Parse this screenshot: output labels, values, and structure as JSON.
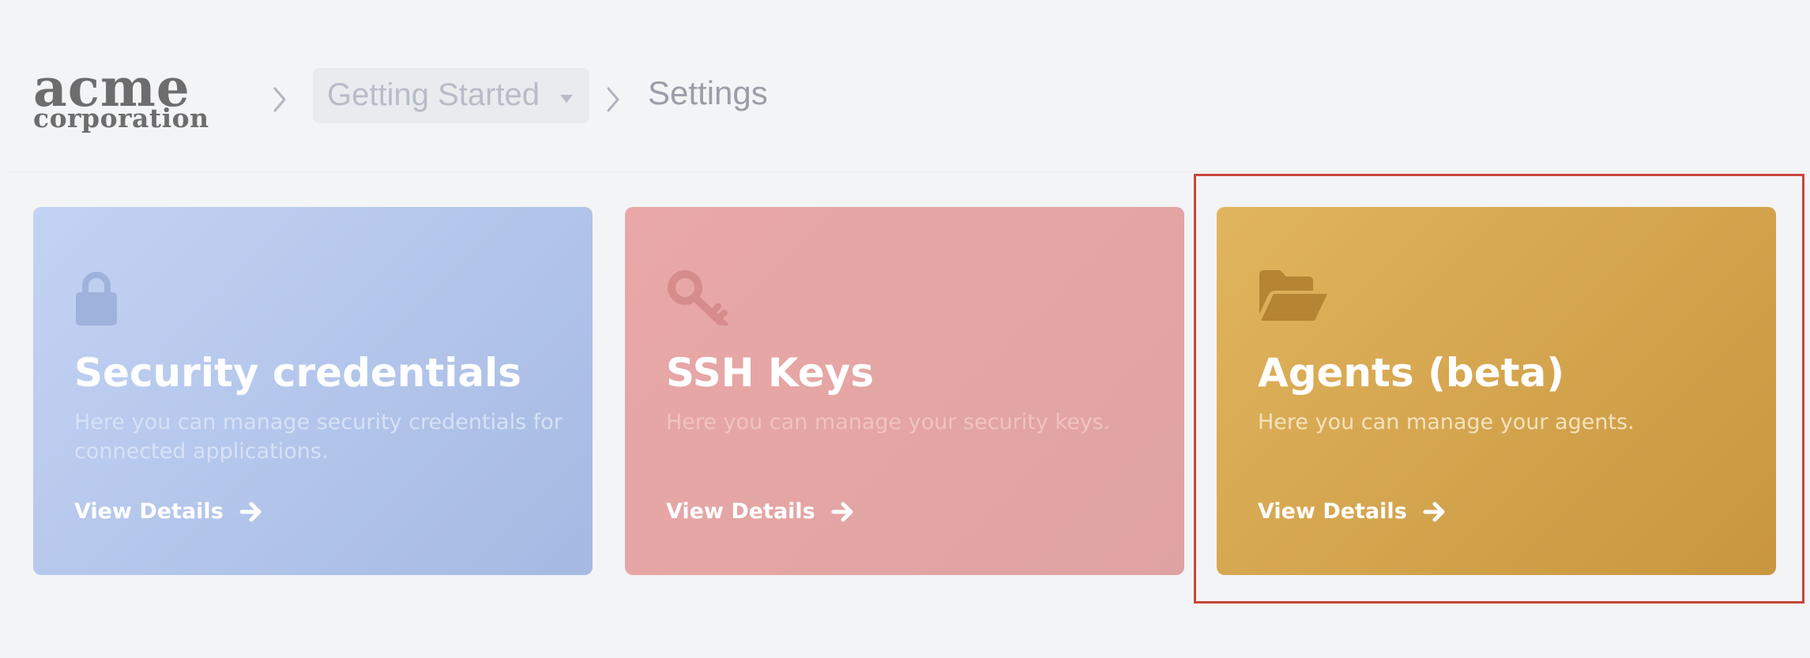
{
  "brand": {
    "logo_line1": "acme",
    "logo_line2": "corporation"
  },
  "breadcrumb": {
    "parent_label": "Getting Started",
    "current_label": "Settings"
  },
  "cards": [
    {
      "title": "Security credentials",
      "description": "Here you can manage security credentials for connected applications.",
      "link_label": "View Details",
      "icon": "lock-icon",
      "color": "#b4c6ec"
    },
    {
      "title": "SSH Keys",
      "description": "Here you can manage your security keys.",
      "link_label": "View Details",
      "icon": "key-icon",
      "color": "#e5a5a4"
    },
    {
      "title": "Agents (beta)",
      "description": "Here you can manage your agents.",
      "link_label": "View Details",
      "icon": "folder-open-icon",
      "color": "#d5a64e"
    }
  ],
  "colors": {
    "background": "#f3f4f6",
    "highlight": "#c9463d"
  }
}
